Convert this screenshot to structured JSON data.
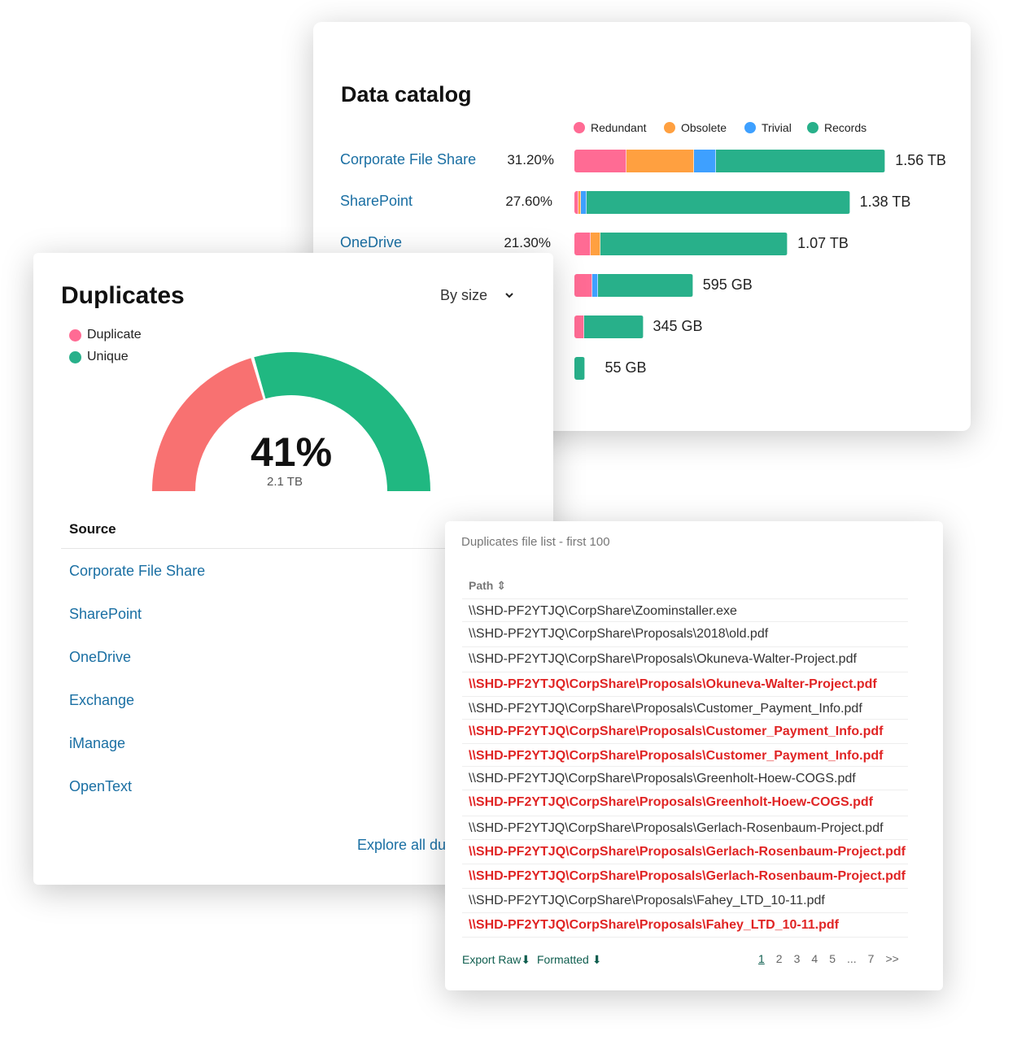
{
  "catalog": {
    "title": "Data catalog",
    "legend": [
      {
        "label": "Redundant",
        "color": "#ff6b94"
      },
      {
        "label": "Obsolete",
        "color": "#ffa040"
      },
      {
        "label": "Trivial",
        "color": "#3ea0ff"
      },
      {
        "label": "Records",
        "color": "#28b08a"
      }
    ],
    "rows": [
      {
        "name": "Corporate File Share",
        "percent": "31.20%",
        "total": "1.56 TB",
        "segments_tb": [
          0.26,
          0.34,
          0.11,
          0.85
        ]
      },
      {
        "name": "SharePoint",
        "percent": "27.60%",
        "total": "1.38 TB",
        "segments_tb": [
          0.02,
          0.01,
          0.03,
          1.32
        ]
      },
      {
        "name": "OneDrive",
        "percent": "21.30%",
        "total": "1.07 TB",
        "segments_tb": [
          0.08,
          0.05,
          0,
          0.94
        ]
      },
      {
        "name": "",
        "percent": "",
        "total": "595 GB",
        "segments_tb": [
          0.09,
          0,
          0.03,
          0.475
        ]
      },
      {
        "name": "",
        "percent": "",
        "total": "345 GB",
        "segments_tb": [
          0.05,
          0,
          0,
          0.295
        ]
      },
      {
        "name": "",
        "percent": "",
        "total": "55 GB",
        "segments_tb": [
          0,
          0,
          0,
          0.055
        ]
      }
    ]
  },
  "duplicates": {
    "title": "Duplicates",
    "dropdown": "By size",
    "legend": [
      {
        "label": "Duplicate",
        "color": "#ff6b94"
      },
      {
        "label": "Unique",
        "color": "#28b08a"
      }
    ],
    "gauge": {
      "percent_label": "41%",
      "size_label": "2.1 TB",
      "duplicate_fraction": 0.41,
      "duplicate_color": "#f87171",
      "unique_color": "#20b881"
    },
    "source_header": "Source",
    "sources": [
      "Corporate File Share",
      "SharePoint",
      "OneDrive",
      "Exchange",
      "iManage",
      "OpenText"
    ],
    "explore": "Explore all duplicates"
  },
  "files": {
    "title": "Duplicates file list - first 100",
    "column": "Path",
    "rows": [
      {
        "path": "\\\\SHD-PF2YTJQ\\CorpShare\\Zoominstaller.exe",
        "dup": false
      },
      {
        "path": "\\\\SHD-PF2YTJQ\\CorpShare\\Proposals\\2018\\old.pdf",
        "dup": false
      },
      {
        "path": "\\\\SHD-PF2YTJQ\\CorpShare\\Proposals\\Okuneva-Walter-Project.pdf",
        "dup": false
      },
      {
        "path": "\\\\SHD-PF2YTJQ\\CorpShare\\Proposals\\Okuneva-Walter-Project.pdf",
        "dup": true
      },
      {
        "path": "\\\\SHD-PF2YTJQ\\CorpShare\\Proposals\\Customer_Payment_Info.pdf",
        "dup": false
      },
      {
        "path": "\\\\SHD-PF2YTJQ\\CorpShare\\Proposals\\Customer_Payment_Info.pdf",
        "dup": true
      },
      {
        "path": "\\\\SHD-PF2YTJQ\\CorpShare\\Proposals\\Customer_Payment_Info.pdf",
        "dup": true
      },
      {
        "path": "\\\\SHD-PF2YTJQ\\CorpShare\\Proposals\\Greenholt-Hoew-COGS.pdf",
        "dup": false
      },
      {
        "path": "\\\\SHD-PF2YTJQ\\CorpShare\\Proposals\\Greenholt-Hoew-COGS.pdf",
        "dup": true
      },
      {
        "path": "\\\\SHD-PF2YTJQ\\CorpShare\\Proposals\\Gerlach-Rosenbaum-Project.pdf",
        "dup": false
      },
      {
        "path": "\\\\SHD-PF2YTJQ\\CorpShare\\Proposals\\Gerlach-Rosenbaum-Project.pdf",
        "dup": true
      },
      {
        "path": "\\\\SHD-PF2YTJQ\\CorpShare\\Proposals\\Gerlach-Rosenbaum-Project.pdf",
        "dup": true
      },
      {
        "path": "\\\\SHD-PF2YTJQ\\CorpShare\\Proposals\\Fahey_LTD_10-11.pdf",
        "dup": false
      },
      {
        "path": "\\\\SHD-PF2YTJQ\\CorpShare\\Proposals\\Fahey_LTD_10-11.pdf",
        "dup": true
      }
    ],
    "export_raw": "Export Raw",
    "formatted": "Formatted",
    "pages": [
      "1",
      "2",
      "3",
      "4",
      "5",
      "...",
      "7",
      ">>"
    ],
    "current_page": "1"
  }
}
